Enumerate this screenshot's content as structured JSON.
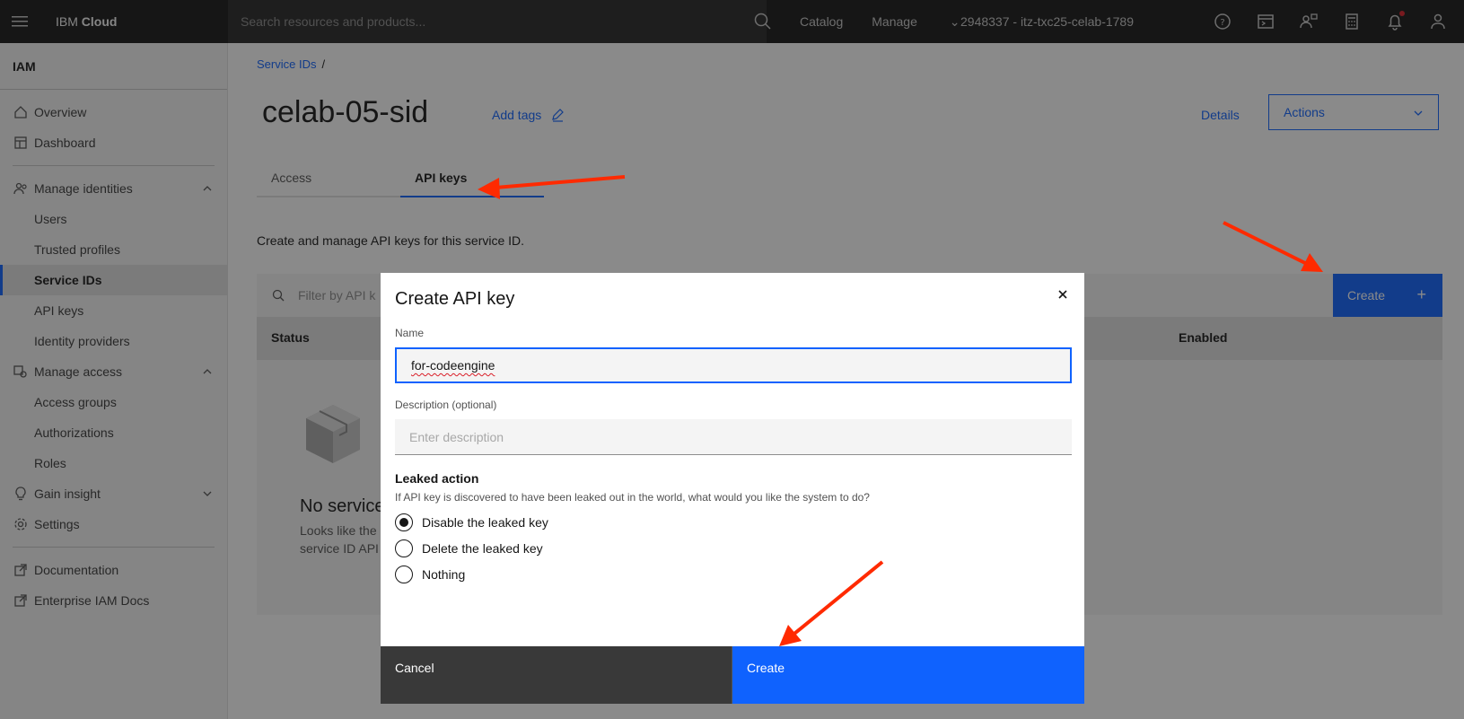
{
  "header": {
    "brand_prefix": "IBM",
    "brand_name": "Cloud",
    "search_placeholder": "Search resources and products...",
    "nav": {
      "catalog": "Catalog",
      "manage": "Manage"
    },
    "account": "2948337 - itz-txc25-celab-1789"
  },
  "sidebar": {
    "title": "IAM",
    "items": {
      "overview": "Overview",
      "dashboard": "Dashboard",
      "manage_identities": "Manage identities",
      "users": "Users",
      "trusted_profiles": "Trusted profiles",
      "service_ids": "Service IDs",
      "api_keys": "API keys",
      "identity_providers": "Identity providers",
      "manage_access": "Manage access",
      "access_groups": "Access groups",
      "authorizations": "Authorizations",
      "roles": "Roles",
      "gain_insight": "Gain insight",
      "settings": "Settings",
      "documentation": "Documentation",
      "enterprise_docs": "Enterprise IAM Docs"
    }
  },
  "page": {
    "breadcrumb": "Service IDs",
    "breadcrumb_sep": "/",
    "title": "celab-05-sid",
    "add_tags": "Add tags",
    "details": "Details",
    "actions": "Actions",
    "tabs": {
      "access": "Access",
      "api_keys": "API keys"
    },
    "description": "Create and manage API keys for this service ID.",
    "filter_placeholder": "Filter by API k",
    "create": "Create",
    "columns": {
      "status": "Status",
      "enabled": "Enabled"
    },
    "empty_title": "No service",
    "empty_text": "Looks like the service ID API"
  },
  "modal": {
    "title": "Create API key",
    "name_label": "Name",
    "name_value": "for-codeengine",
    "desc_label": "Description (optional)",
    "desc_placeholder": "Enter description",
    "leak_title": "Leaked action",
    "leak_help": "If API key is discovered to have been leaked out in the world, what would you like the system to do?",
    "options": {
      "disable": "Disable the leaked key",
      "delete": "Delete the leaked key",
      "nothing": "Nothing"
    },
    "cancel": "Cancel",
    "create": "Create"
  },
  "colors": {
    "accent": "#0f62fe",
    "arrow": "#ff2a00",
    "header": "#161616"
  }
}
